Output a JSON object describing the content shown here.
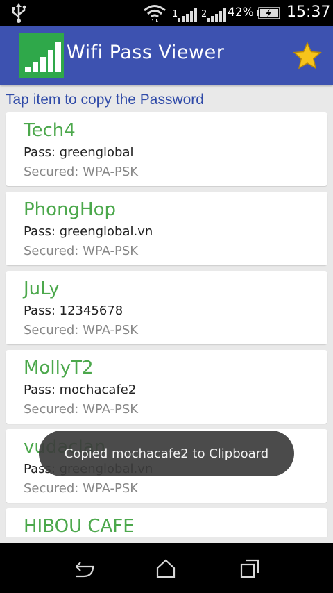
{
  "status_bar": {
    "signal_1_label": "1",
    "signal_2_label": "2",
    "battery_pct": "42%",
    "time": "15:37",
    "icons": [
      "usb-icon",
      "wifi-icon",
      "signal-icon",
      "signal-icon",
      "battery-charging-icon"
    ]
  },
  "action_bar": {
    "title": "Wifi Pass Viewer",
    "icon": "wifi-bars-icon",
    "action_icon": "star-icon",
    "brand_color": "#3d52b0"
  },
  "hint": "Tap item to copy the Password",
  "networks": [
    {
      "ssid": "Tech4",
      "pass": "Pass: greenglobal",
      "security": "Secured: WPA-PSK"
    },
    {
      "ssid": "PhongHop",
      "pass": "Pass: greenglobal.vn",
      "security": "Secured: WPA-PSK"
    },
    {
      "ssid": "JuLy",
      "pass": "Pass: 12345678",
      "security": "Secured: WPA-PSK"
    },
    {
      "ssid": "MollyT2",
      "pass": "Pass: mochacafe2",
      "security": "Secured: WPA-PSK"
    },
    {
      "ssid": "vudaclan",
      "pass": "Pass: greenglobal.vn",
      "security": "Secured: WPA-PSK"
    },
    {
      "ssid": "HIBOU CAFE",
      "pass": "",
      "security": ""
    }
  ],
  "toast": "Copied mochacafe2 to Clipboard",
  "nav_bar": {
    "icons": [
      "back-icon",
      "home-icon",
      "recent-apps-icon"
    ]
  }
}
